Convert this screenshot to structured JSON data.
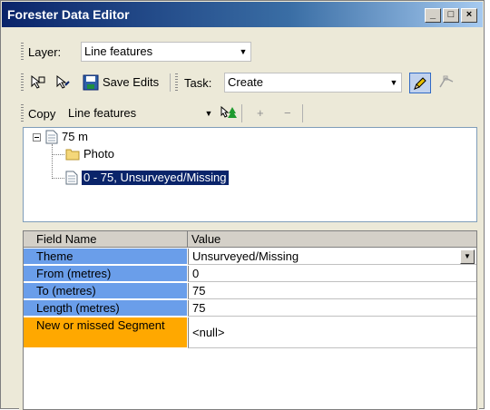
{
  "window": {
    "title": "Forester Data Editor"
  },
  "toolbar_layer": {
    "label": "Layer:",
    "value": "Line features"
  },
  "toolbar_edit": {
    "save_label": "Save Edits",
    "task_label": "Task:",
    "task_value": "Create"
  },
  "toolbar_copy": {
    "copy_label": "Copy",
    "copy_value": "Line features",
    "plus": "+",
    "minus": "−"
  },
  "tree": {
    "root": "75 m",
    "children": [
      "Photo",
      "0 - 75, Unsurveyed/Missing"
    ]
  },
  "grid": {
    "columns": [
      "Field Name",
      "Value"
    ],
    "rows": [
      {
        "name": "Theme",
        "value": "Unsurveyed/Missing"
      },
      {
        "name": "From (metres)",
        "value": "0"
      },
      {
        "name": "To (metres)",
        "value": "75"
      },
      {
        "name": "Length (metres)",
        "value": "75"
      },
      {
        "name": "New or missed Segment",
        "value": "<null>"
      }
    ]
  },
  "colors": {
    "title_bar": "#0a246a",
    "field_name_bg": "#6a9eea",
    "required_field_bg": "#ffa800"
  }
}
